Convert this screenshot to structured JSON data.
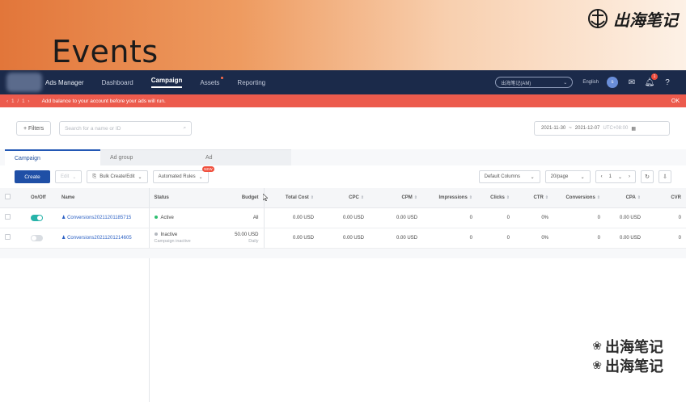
{
  "slide": {
    "title": "Events",
    "brand_logo_text": "出海笔记"
  },
  "topnav": {
    "app_name": "Ads Manager",
    "items": [
      {
        "label": "Dashboard",
        "active": false
      },
      {
        "label": "Campaign",
        "active": true
      },
      {
        "label": "Assets",
        "active": false
      },
      {
        "label": "Reporting",
        "active": false
      }
    ],
    "account_select_value": "出海笔记(AM)",
    "language": "English",
    "avatar_letter": "s",
    "notification_count": "1"
  },
  "alert": {
    "pager": "‹ 1 / 1 ›",
    "message": "Add balance to your account before your ads will run.",
    "close": "OK"
  },
  "filterbar": {
    "filters_label": "+ Filters",
    "search_placeholder": "Search for a name or ID",
    "date_start": "2021-11-30",
    "date_sep": "~",
    "date_end": "2021-12-07",
    "timezone": "UTC+08:00"
  },
  "tabs": [
    {
      "label": "Campaign",
      "active": true
    },
    {
      "label": "Ad group",
      "active": false
    },
    {
      "label": "Ad",
      "active": false
    }
  ],
  "toolbar": {
    "create_label": "Create",
    "edit_label": "Edit",
    "bulk_label": "Bulk Create/Edit",
    "rules_label": "Automated Rules",
    "rules_badge": "NEW",
    "columns_label": "Default Columns",
    "page_size_label": "20/page",
    "page_number": "1"
  },
  "table": {
    "columns": [
      "On/Off",
      "Name",
      "Status",
      "Budget",
      "Total Cost",
      "CPC",
      "CPM",
      "Impressions",
      "Clicks",
      "CTR",
      "Conversions",
      "CPA",
      "CVR"
    ],
    "rows": [
      {
        "on": true,
        "name": "Conversions20211201185715",
        "status": "Active",
        "status_color": "#2fbf71",
        "status_sub": "",
        "budget": "All",
        "budget_sub": "",
        "total_cost": "0.00 USD",
        "cpc": "0.00 USD",
        "cpm": "0.00 USD",
        "impressions": "0",
        "clicks": "0",
        "ctr": "0%",
        "conversions": "0",
        "cpa": "0.00 USD",
        "cvr": "0"
      },
      {
        "on": false,
        "name": "Conversions20211201214605",
        "status": "Inactive",
        "status_color": "#b4b8bf",
        "status_sub": "Campaign inactive",
        "budget": "50.00 USD",
        "budget_sub": "Daily",
        "total_cost": "0.00 USD",
        "cpc": "0.00 USD",
        "cpm": "0.00 USD",
        "impressions": "0",
        "clicks": "0",
        "ctr": "0%",
        "conversions": "0",
        "cpa": "0.00 USD",
        "cvr": "0"
      }
    ]
  },
  "watermark": {
    "text": "出海笔记"
  },
  "colors": {
    "nav_bg": "#1b2a4a",
    "alert_bg": "#ec5b4d",
    "primary": "#1f4fa6",
    "toggle_on": "#27b3a9"
  }
}
